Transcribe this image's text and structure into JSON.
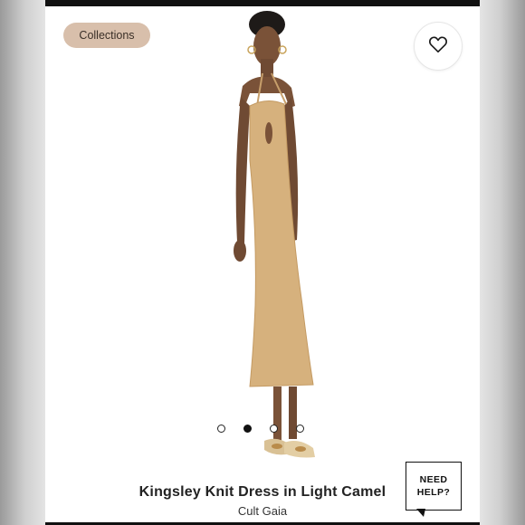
{
  "header": {
    "collections_label": "Collections"
  },
  "product": {
    "title": "Kingsley Knit Dress in Light Camel",
    "brand": "Cult Gaia",
    "image_count": 4,
    "active_image_index": 1
  },
  "help": {
    "line1": "NEED",
    "line2": "HELP?"
  },
  "icons": {
    "favorite": "heart-outline-icon"
  },
  "colors": {
    "pill_bg": "#d8bfab",
    "dress": "#d6b17d"
  }
}
